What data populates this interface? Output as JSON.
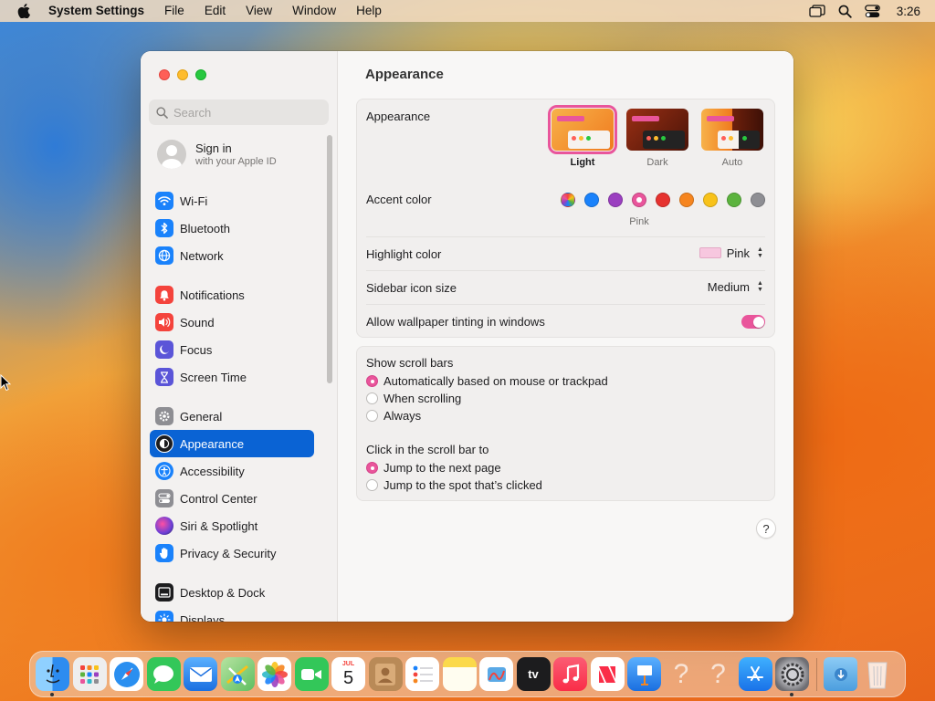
{
  "menubar": {
    "app_name": "System Settings",
    "items": [
      "File",
      "Edit",
      "View",
      "Window",
      "Help"
    ],
    "clock": "3:26"
  },
  "window": {
    "search": {
      "placeholder": "Search"
    },
    "signin": {
      "title": "Sign in",
      "subtitle": "with your Apple ID"
    },
    "sidebar": {
      "items": [
        {
          "label": "Wi-Fi",
          "icon": "wifi-icon",
          "color": "#1a82fb"
        },
        {
          "label": "Bluetooth",
          "icon": "bluetooth-icon",
          "color": "#1a82fb"
        },
        {
          "label": "Network",
          "icon": "globe-icon",
          "color": "#1a82fb"
        },
        {
          "label": "Notifications",
          "icon": "bell-icon",
          "color": "#f4433c"
        },
        {
          "label": "Sound",
          "icon": "speaker-icon",
          "color": "#f4433c"
        },
        {
          "label": "Focus",
          "icon": "moon-icon",
          "color": "#5b55d8"
        },
        {
          "label": "Screen Time",
          "icon": "hourglass-icon",
          "color": "#5b55d8"
        },
        {
          "label": "General",
          "icon": "gear-icon",
          "color": "#8e8e93"
        },
        {
          "label": "Appearance",
          "icon": "appearance-icon",
          "color": "#1d1d1f"
        },
        {
          "label": "Accessibility",
          "icon": "accessibility-icon",
          "color": "#1a82fb"
        },
        {
          "label": "Control Center",
          "icon": "control-center-icon",
          "color": "#8e8e93"
        },
        {
          "label": "Siri & Spotlight",
          "icon": "siri-icon",
          "color": "#c03bc4"
        },
        {
          "label": "Privacy & Security",
          "icon": "hand-icon",
          "color": "#1a82fb"
        },
        {
          "label": "Desktop & Dock",
          "icon": "dock-icon",
          "color": "#1d1d1f"
        },
        {
          "label": "Displays",
          "icon": "sun-icon",
          "color": "#1a82fb"
        }
      ],
      "active": "Appearance"
    },
    "content": {
      "title": "Appearance",
      "appearance": {
        "label": "Appearance",
        "options": [
          "Light",
          "Dark",
          "Auto"
        ],
        "selected": "Light"
      },
      "accent": {
        "label": "Accent color",
        "colors": [
          "multicolor",
          "#1a82fb",
          "#9b3fc0",
          "#e9559b",
          "#e6322f",
          "#f6851f",
          "#f8c21a",
          "#5cb33e",
          "#8e8e93"
        ],
        "selected_name": "Pink"
      },
      "highlight": {
        "label": "Highlight color",
        "value": "Pink",
        "swatch": "#f7c7df"
      },
      "icon_size": {
        "label": "Sidebar icon size",
        "value": "Medium"
      },
      "tinting": {
        "label": "Allow wallpaper tinting in windows",
        "on": true
      },
      "scrollbars": {
        "label": "Show scroll bars",
        "options": [
          "Automatically based on mouse or trackpad",
          "When scrolling",
          "Always"
        ],
        "selected": 0
      },
      "click": {
        "label": "Click in the scroll bar to",
        "options": [
          "Jump to the next page",
          "Jump to the spot that’s clicked"
        ],
        "selected": 0
      },
      "help": "?"
    }
  },
  "dock": {
    "items": [
      {
        "name": "finder-icon",
        "color": "#2d8cf0",
        "running": true
      },
      {
        "name": "launchpad-icon",
        "color": "#eeeeee"
      },
      {
        "name": "safari-icon",
        "color": "#2a8ff0"
      },
      {
        "name": "messages-icon",
        "color": "#33c759"
      },
      {
        "name": "mail-icon",
        "color": "#2f8df0"
      },
      {
        "name": "maps-icon",
        "color": "#5fbf61"
      },
      {
        "name": "photos-icon",
        "color": "#ffffff"
      },
      {
        "name": "facetime-icon",
        "color": "#33c759"
      },
      {
        "name": "calendar-icon",
        "color": "#ffffff",
        "month": "JUL",
        "day": "5"
      },
      {
        "name": "contacts-icon",
        "color": "#b98a57"
      },
      {
        "name": "reminders-icon",
        "color": "#ffffff"
      },
      {
        "name": "notes-icon",
        "color": "#fbd94a"
      },
      {
        "name": "freeform-icon",
        "color": "#ffffff"
      },
      {
        "name": "tv-icon",
        "color": "#1c1c1e",
        "text": "tv"
      },
      {
        "name": "music-icon",
        "color": "#fa3c51"
      },
      {
        "name": "news-icon",
        "color": "#ffffff"
      },
      {
        "name": "keynote-icon",
        "color": "#2d8cf0"
      },
      {
        "name": "unknown-app-icon",
        "color": "transparent"
      },
      {
        "name": "unknown-app-icon",
        "color": "transparent"
      },
      {
        "name": "app-store-icon",
        "color": "#1a82fb"
      },
      {
        "name": "system-settings-icon",
        "color": "#8e8e93",
        "running": true
      },
      {
        "name": "downloads-folder-icon",
        "color": "#5aa9e6"
      },
      {
        "name": "trash-icon",
        "color": "transparent"
      }
    ]
  }
}
